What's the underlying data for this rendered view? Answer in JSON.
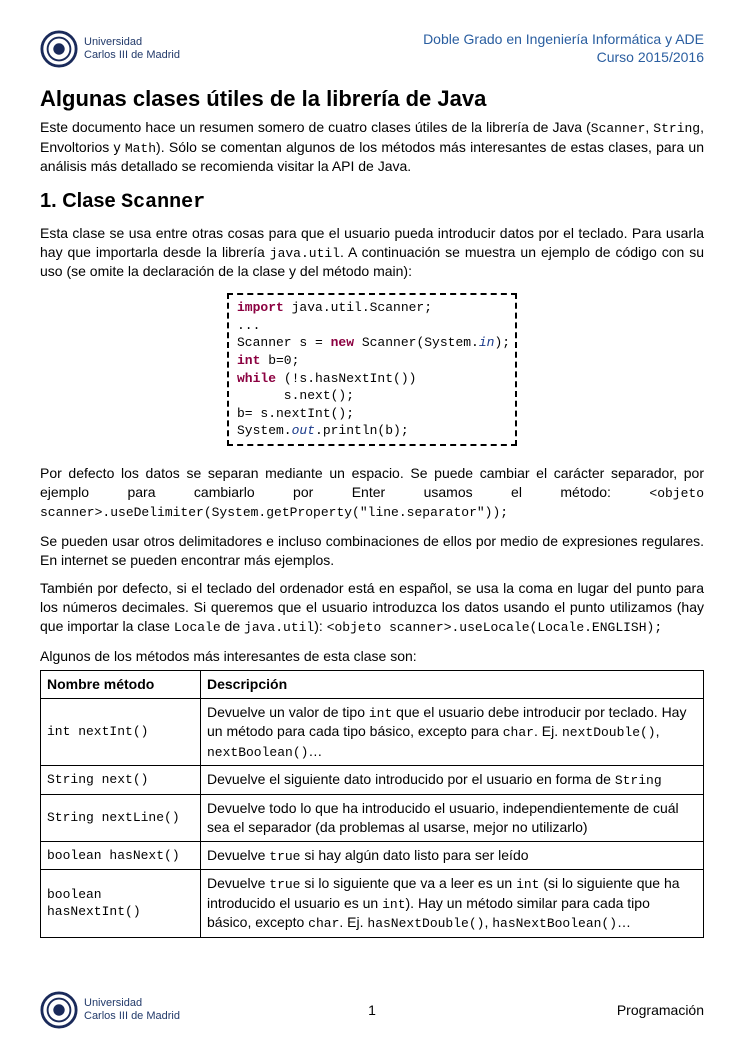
{
  "header": {
    "uni_line1": "Universidad",
    "uni_line2": "Carlos III de Madrid",
    "right_line1": "Doble Grado en Ingeniería Informática y ADE",
    "right_line2": "Curso 2015/2016"
  },
  "title": "Algunas clases útiles de la librería de Java",
  "intro": {
    "p1_before": "Este documento hace un resumen somero de cuatro clases útiles de la librería de Java (",
    "c1": "Scanner",
    "p1_mid1": ", ",
    "c2": "String",
    "p1_mid2": ", Envoltorios y ",
    "c3": "Math",
    "p1_after": "). Sólo se comentan algunos de los métodos más interesantes de estas clases, para un análisis más detallado se recomienda visitar la API de Java."
  },
  "section1": {
    "heading_prefix": "1. Clase ",
    "heading_class": "Scanner",
    "p1_before": "Esta clase se usa entre otras cosas para que el usuario pueda introducir datos por el teclado. Para usarla hay que importarla desde la librería ",
    "p1_code": "java.util",
    "p1_after": ". A continuación se muestra un ejemplo de código con su uso (se omite la declaración de la clase y del método main):",
    "code": {
      "l1_kw": "import",
      "l1_rest": " java.util.Scanner;",
      "l2": "...",
      "l3a": "Scanner s = ",
      "l3_kw": "new",
      "l3b": " Scanner(System.",
      "l3_it": "in",
      "l3c": ");",
      "l4_kw": "int",
      "l4_rest": " b=0;",
      "l5_kw": "while",
      "l5_rest": " (!s.hasNextInt())",
      "l6": "      s.next();",
      "l7": "b= s.nextInt();",
      "l8a": "System.",
      "l8_it": "out",
      "l8b": ".println(b);"
    },
    "p2_before": "Por defecto los datos se separan mediante un espacio. Se puede cambiar el carácter separador, por ejemplo para cambiarlo por Enter usamos el método: ",
    "p2_code": "<objeto scanner>.useDelimiter(System.getProperty(\"line.separator\"));",
    "p3": "Se pueden usar otros delimitadores e incluso combinaciones de ellos por medio de expresiones regulares. En internet se pueden encontrar más ejemplos.",
    "p4_before": "También por defecto, si el teclado del ordenador está en español, se usa la coma en lugar del punto para los números decimales. Si queremos que el usuario introduzca los datos usando el punto utilizamos (hay que importar la clase ",
    "p4_c1": "Locale",
    "p4_mid": " de ",
    "p4_c2": "java.util",
    "p4_after": "): ",
    "p4_code": "<objeto scanner>.useLocale(Locale.ENGLISH);",
    "table_intro": "Algunos de los métodos más interesantes de esta clase son:",
    "table": {
      "h1": "Nombre método",
      "h2": "Descripción",
      "rows": [
        {
          "name": "int nextInt()",
          "d1": "Devuelve un valor de tipo ",
          "dc1": "int",
          "d2": " que el usuario debe introducir por teclado. Hay un método para cada tipo básico, excepto para ",
          "dc2": "char",
          "d3": ". Ej. ",
          "dc3": "nextDouble()",
          "d4": ", ",
          "dc4": "nextBoolean()",
          "d5": "…"
        },
        {
          "name": "String next()",
          "d1": "Devuelve el siguiente dato introducido por el usuario en forma de ",
          "dc1": "String",
          "d2": ""
        },
        {
          "name": "String nextLine()",
          "d1": "Devuelve todo lo que ha introducido el usuario, independientemente de cuál sea el separador (da problemas al usarse, mejor no utilizarlo)"
        },
        {
          "name": "boolean hasNext()",
          "d1": "Devuelve ",
          "dc1": "true",
          "d2": " si hay algún dato listo para ser leído"
        },
        {
          "name": "boolean hasNextInt()",
          "d1": "Devuelve ",
          "dc1": "true",
          "d2": " si lo siguiente que va a leer es un ",
          "dc2": "int",
          "d3": " (si lo siguiente que ha introducido el usuario es un ",
          "dc3": "int",
          "d4": "). Hay un método similar para cada tipo básico, excepto ",
          "dc4": "char",
          "d5": ". Ej. ",
          "dc5": "hasNextDouble()",
          "d6": ", ",
          "dc6": "hasNextBoolean()",
          "d7": "…"
        }
      ]
    }
  },
  "footer": {
    "page": "1",
    "right": "Programación"
  }
}
